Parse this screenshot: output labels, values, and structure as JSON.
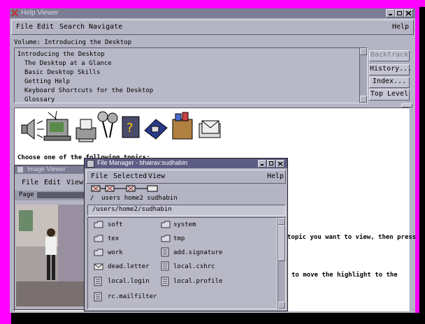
{
  "help_viewer": {
    "title": "Help Viewer",
    "menu": [
      "File",
      "Edit",
      "Search",
      "Navigate"
    ],
    "help": "Help",
    "volume_label": "Volume:",
    "volume_name": "Introducing the Desktop",
    "topics": [
      "Introducing the Desktop",
      "The Desktop at a Glance",
      "Basic Desktop Skills",
      "Getting Help",
      "Keyboard Shortcuts for the Desktop",
      "Glossary"
    ],
    "buttons": [
      "Backtrack",
      "History...",
      "Index...",
      "Top Level"
    ],
    "body_text": "Choose one of the following topics:",
    "frag1": "topic you want to view, then press",
    "frag2": "to move the highlight to the"
  },
  "image_viewer": {
    "title": "Image Viewer",
    "menu": [
      "File",
      "Edit",
      "View"
    ],
    "page_label": "Page"
  },
  "file_manager": {
    "title": "File Manager - bhairav:sudhabin",
    "menu": [
      "File",
      "Selected",
      "View"
    ],
    "help": "Help",
    "path_labels": "/  users home2 sudhabin",
    "path_field": "/users/home2/sudhabin",
    "files": [
      {
        "name": "soft",
        "kind": "folder"
      },
      {
        "name": "system",
        "kind": "folder"
      },
      {
        "name": "tex",
        "kind": "folder"
      },
      {
        "name": "tmp",
        "kind": "folder"
      },
      {
        "name": "work",
        "kind": "folder"
      },
      {
        "name": "add.signature",
        "kind": "file"
      },
      {
        "name": "dead.letter",
        "kind": "mail"
      },
      {
        "name": "local.cshrc",
        "kind": "file"
      },
      {
        "name": "local.login",
        "kind": "file"
      },
      {
        "name": "local.profile",
        "kind": "file"
      },
      {
        "name": "rc.mailfilter",
        "kind": "file"
      }
    ]
  },
  "colors": {
    "frame": "#ff00ff",
    "titlebar": "#7c7c94",
    "window": "#b4b4c4"
  }
}
